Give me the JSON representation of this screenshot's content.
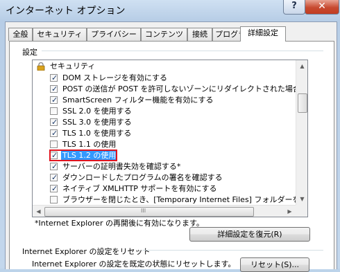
{
  "window": {
    "title": "インターネット オプション",
    "help_label": "?",
    "close_label": "✕"
  },
  "tabs": [
    {
      "label": "全般"
    },
    {
      "label": "セキュリティ"
    },
    {
      "label": "プライバシー"
    },
    {
      "label": "コンテンツ"
    },
    {
      "label": "接続"
    },
    {
      "label": "プログラム"
    },
    {
      "label": "詳細設定",
      "active": true
    }
  ],
  "settings": {
    "group_label": "設定",
    "category": "セキュリティ",
    "items": [
      {
        "label": "DOM ストレージを有効にする",
        "checked": true
      },
      {
        "label": "POST の送信が POST を許可しないゾーンにリダイレクトされた場合に警",
        "checked": true
      },
      {
        "label": "SmartScreen フィルター機能を有効にする",
        "checked": true
      },
      {
        "label": "SSL 2.0 を使用する",
        "checked": false
      },
      {
        "label": "SSL 3.0 を使用する",
        "checked": true
      },
      {
        "label": "TLS 1.0 を使用する",
        "checked": true
      },
      {
        "label": "TLS 1.1 の使用",
        "checked": false
      },
      {
        "label": "TLS 1.2 の使用",
        "checked": true,
        "selected": true,
        "highlighted": true
      },
      {
        "label": "サーバーの証明書失効を確認する*",
        "checked": true
      },
      {
        "label": "ダウンロードしたプログラムの署名を確認する",
        "checked": true
      },
      {
        "label": "ネイティブ XMLHTTP サポートを有効にする",
        "checked": true
      },
      {
        "label": "ブラウザーを閉じたとき、[Temporary Internet Files] フォルダーを空にす",
        "checked": false
      }
    ],
    "restart_note": "*Internet Explorer の再開後に有効になります。",
    "restore_button": "詳細設定を復元(R)"
  },
  "reset": {
    "group_label": "Internet Explorer の設定をリセット",
    "description": "Internet Explorer の設定を既定の状態にリセットします。",
    "button": "リセット(S)..."
  },
  "scroll": {
    "up_icon": "▲",
    "down_icon": "▼",
    "left_icon": "◀",
    "right_icon": "▶",
    "grip": "III"
  },
  "colors": {
    "selection": "#3399ff",
    "highlight_box": "#e1141e",
    "close_button": "#c74a30"
  }
}
